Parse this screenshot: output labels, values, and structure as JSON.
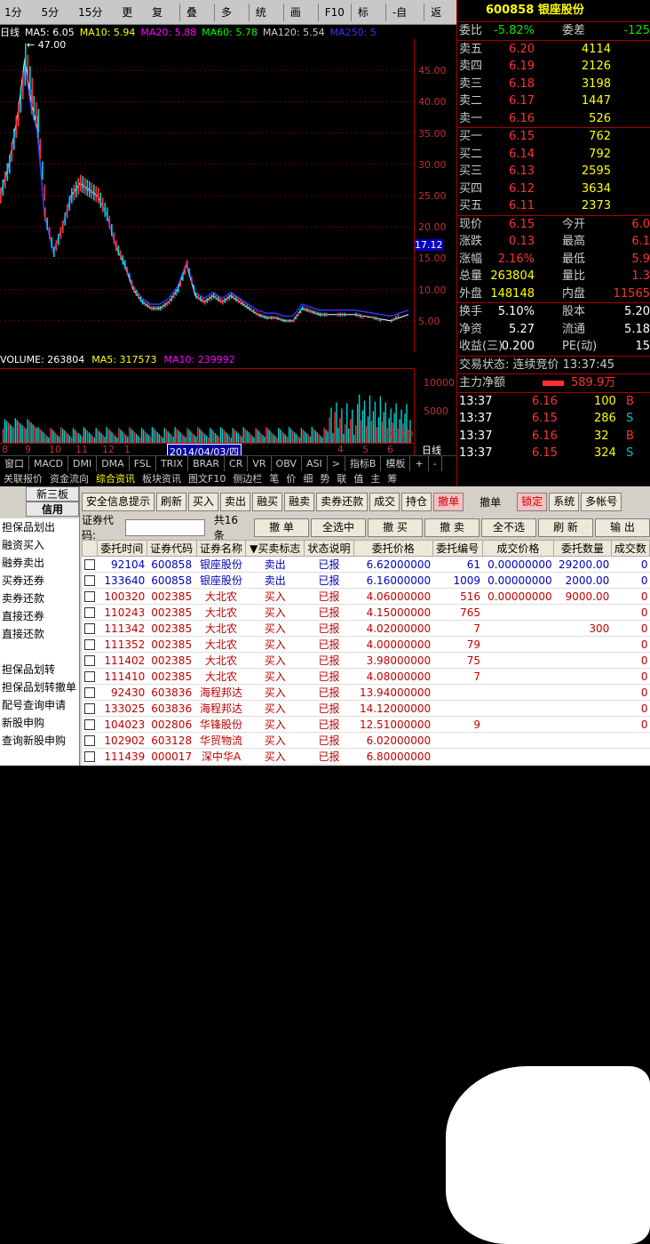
{
  "toolbar": {
    "items": [
      "1分钟",
      "5分钟",
      "15分钟",
      "更多",
      "复权",
      "叠加",
      "多股",
      "统计",
      "画线",
      "F10",
      "标记",
      "-自选",
      "返回"
    ]
  },
  "ma_line": {
    "period": "日线",
    "ma5": "MA5: 6.05",
    "ma10": "MA10: 5.94",
    "ma20": "MA20: 5.88",
    "ma60": "MA60: 5.78",
    "ma120": "MA120: 5.54",
    "ma250": "MA250: 5",
    "peak": "47.00"
  },
  "price_axis": [
    "45.00",
    "40.00",
    "35.00",
    "30.00",
    "25.00",
    "20.00",
    "17.12",
    "15.00",
    "10.00",
    "5.00"
  ],
  "volume": {
    "label": "VOLUME: 263804",
    "ma5": "MA5: 317573",
    "ma10": "MA10: 239992",
    "axis": [
      "10000",
      "5000"
    ],
    "unit": "X100"
  },
  "dates": [
    "8",
    "9",
    "10",
    "11",
    "12",
    "1",
    "2014/04/03/四",
    "4",
    "5",
    "6"
  ],
  "baixian": "日线",
  "ind_tabs": [
    "窗口",
    "MACD",
    "DMI",
    "DMA",
    "FSL",
    "TRIX",
    "BRAR",
    "CR",
    "VR",
    "OBV",
    "ASI",
    ">",
    "指标B",
    "模板",
    "+",
    "-"
  ],
  "nav_tabs": [
    "关联报价",
    "资金流向",
    "综合资讯",
    "板块资讯",
    "图文F10",
    "侧边栏",
    "笔",
    "价",
    "细",
    "势",
    "联",
    "值",
    "主",
    "筹"
  ],
  "quote": {
    "code": "600858",
    "name": "银座股份",
    "weibi_lbl": "委比",
    "weibi": "-5.82%",
    "weicha_lbl": "委差",
    "weicha": "-125",
    "sells": [
      {
        "l": "卖五",
        "p": "6.20",
        "v": "4114"
      },
      {
        "l": "卖四",
        "p": "6.19",
        "v": "2126"
      },
      {
        "l": "卖三",
        "p": "6.18",
        "v": "3198"
      },
      {
        "l": "卖二",
        "p": "6.17",
        "v": "1447"
      },
      {
        "l": "卖一",
        "p": "6.16",
        "v": "526"
      }
    ],
    "buys": [
      {
        "l": "买一",
        "p": "6.15",
        "v": "762"
      },
      {
        "l": "买二",
        "p": "6.14",
        "v": "792"
      },
      {
        "l": "买三",
        "p": "6.13",
        "v": "2595"
      },
      {
        "l": "买四",
        "p": "6.12",
        "v": "3634"
      },
      {
        "l": "买五",
        "p": "6.11",
        "v": "2373"
      }
    ],
    "stats": [
      {
        "l1": "现价",
        "v1": "6.15",
        "l2": "今开",
        "v2": "6.0"
      },
      {
        "l1": "涨跌",
        "v1": "0.13",
        "l2": "最高",
        "v2": "6.1"
      },
      {
        "l1": "涨幅",
        "v1": "2.16%",
        "l2": "最低",
        "v2": "5.9"
      },
      {
        "l1": "总量",
        "v1": "263804",
        "l2": "量比",
        "v2": "1.3"
      },
      {
        "l1": "外盘",
        "v1": "148148",
        "l2": "内盘",
        "v2": "11565"
      }
    ],
    "stats2": [
      {
        "l1": "换手",
        "v1": "5.10%",
        "l2": "股本",
        "v2": "5.20"
      },
      {
        "l1": "净资",
        "v1": "5.27",
        "l2": "流通",
        "v2": "5.18"
      },
      {
        "l1": "收益(三)",
        "v1": "0.200",
        "l2": "PE(动)",
        "v2": "15"
      }
    ],
    "status": "交易状态: 连续竞价 13:37:45",
    "zhuli_lbl": "主力净额",
    "zhuli": "589.9万",
    "ticks": [
      {
        "t": "13:37",
        "p": "6.16",
        "v": "100",
        "s": "B"
      },
      {
        "t": "13:37",
        "p": "6.15",
        "v": "286",
        "s": "S"
      },
      {
        "t": "13:37",
        "p": "6.16",
        "v": "32",
        "s": "B"
      },
      {
        "t": "13:37",
        "p": "6.15",
        "v": "324",
        "s": "S"
      }
    ]
  },
  "trade": {
    "sb_top": [
      "新三板",
      "信用"
    ],
    "sb_items": [
      "担保品划出",
      "融资买入",
      "融券卖出",
      "买券还券",
      "卖券还款",
      "直接还券",
      "直接还款",
      "",
      "担保品划转",
      "担保品划转撤单",
      "配号查询申请",
      "新股申购",
      "查询新股申购"
    ],
    "tb1": [
      "安全信息提示",
      "刷新",
      "买入",
      "卖出",
      "融买",
      "融卖",
      "卖券还款",
      "成交",
      "持仓",
      "撤单",
      "撤单",
      "锁定",
      "系统",
      "多帐号"
    ],
    "code_lbl": "证券代码:",
    "count": "共16条",
    "tb2": [
      "撤 单",
      "全选中",
      "撤 买",
      "撤 卖",
      "全不选",
      "刷 新",
      "输 出"
    ],
    "cols": [
      "委托时间",
      "证券代码",
      "证券名称",
      "▼买卖标志",
      "状态说明",
      "委托价格",
      "委托编号",
      "成交价格",
      "委托数量",
      "成交数"
    ],
    "rows": [
      [
        "92104",
        "600858",
        "银座股份",
        "卖出",
        "已报",
        "6.62000000",
        "61",
        "0.00000000",
        "29200.00",
        "0"
      ],
      [
        "133640",
        "600858",
        "银座股份",
        "卖出",
        "已报",
        "6.16000000",
        "1009",
        "0.00000000",
        "2000.00",
        "0"
      ],
      [
        "100320",
        "002385",
        "大北农",
        "买入",
        "已报",
        "4.06000000",
        "516",
        "0.00000000",
        "9000.00",
        "0"
      ],
      [
        "110243",
        "002385",
        "大北农",
        "买入",
        "已报",
        "4.15000000",
        "765",
        "",
        "",
        "0"
      ],
      [
        "111342",
        "002385",
        "大北农",
        "买入",
        "已报",
        "4.02000000",
        "7",
        "",
        "300",
        "0"
      ],
      [
        "111352",
        "002385",
        "大北农",
        "买入",
        "已报",
        "4.00000000",
        "79",
        "",
        "",
        "0"
      ],
      [
        "111402",
        "002385",
        "大北农",
        "买入",
        "已报",
        "3.98000000",
        "75",
        "",
        "",
        "0"
      ],
      [
        "111410",
        "002385",
        "大北农",
        "买入",
        "已报",
        "4.08000000",
        "7",
        "",
        "",
        "0"
      ],
      [
        "92430",
        "603836",
        "海程邦达",
        "买入",
        "已报",
        "13.94000000",
        "",
        "",
        "",
        "0"
      ],
      [
        "133025",
        "603836",
        "海程邦达",
        "买入",
        "已报",
        "14.12000000",
        "",
        "",
        "",
        "0"
      ],
      [
        "104023",
        "002806",
        "华锋股份",
        "买入",
        "已报",
        "12.51000000",
        "9",
        "",
        "",
        "0"
      ],
      [
        "102902",
        "603128",
        "华贸物流",
        "买入",
        "已报",
        "6.02000000",
        "",
        "",
        "",
        ""
      ],
      [
        "111439",
        "000017",
        "深中华A",
        "买入",
        "已报",
        "6.80000000",
        "",
        "",
        "",
        ""
      ]
    ]
  },
  "chart_data": {
    "type": "candlestick",
    "title": "",
    "price_range": [
      0,
      50
    ]
  }
}
